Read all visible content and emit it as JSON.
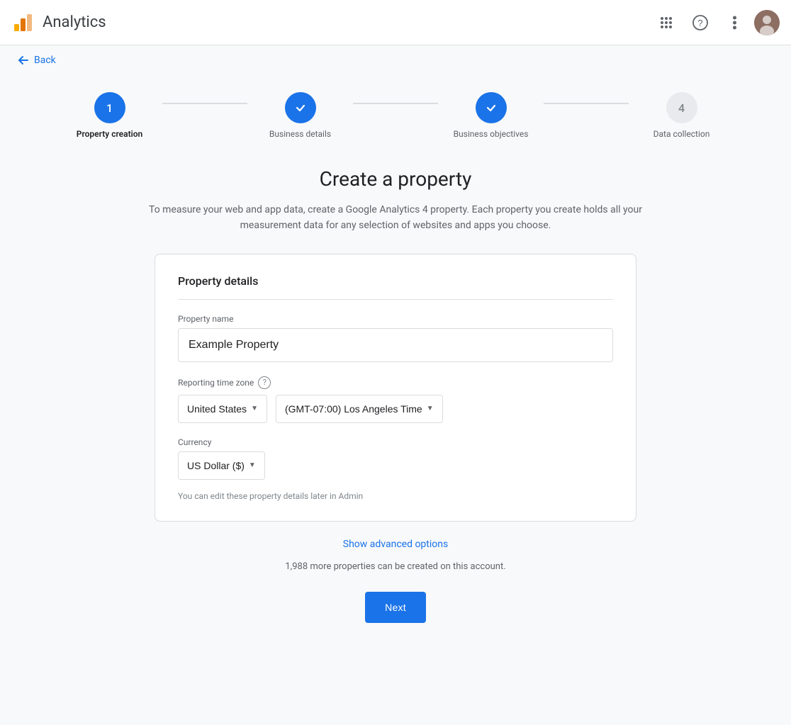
{
  "header": {
    "title": "Analytics",
    "apps_icon": "⋮⋮⋮",
    "help_icon": "?",
    "more_icon": "⋮"
  },
  "back": {
    "label": "Back"
  },
  "stepper": {
    "steps": [
      {
        "id": "property-creation",
        "number": "1",
        "label": "Property creation",
        "state": "active"
      },
      {
        "id": "business-details",
        "number": "✓",
        "label": "Business details",
        "state": "completed"
      },
      {
        "id": "business-objectives",
        "number": "✓",
        "label": "Business objectives",
        "state": "completed"
      },
      {
        "id": "data-collection",
        "number": "4",
        "label": "Data collection",
        "state": "pending"
      }
    ]
  },
  "page": {
    "title": "Create a property",
    "description": "To measure your web and app data, create a Google Analytics 4 property. Each property you create holds all your measurement data for any selection of websites and apps you choose."
  },
  "form": {
    "card_title": "Property details",
    "property_name_label": "Property name",
    "property_name_value": "Example Property",
    "property_name_placeholder": "Example Property",
    "timezone_label": "Reporting time zone",
    "timezone_help": "?",
    "country_value": "United States",
    "timezone_value": "(GMT-07:00) Los Angeles Time",
    "currency_label": "Currency",
    "currency_value": "US Dollar ($)",
    "hint": "You can edit these property details later in Admin"
  },
  "advanced": {
    "label": "Show advanced options"
  },
  "footer": {
    "properties_note": "1,988 more properties can be created on this account.",
    "next_label": "Next"
  }
}
